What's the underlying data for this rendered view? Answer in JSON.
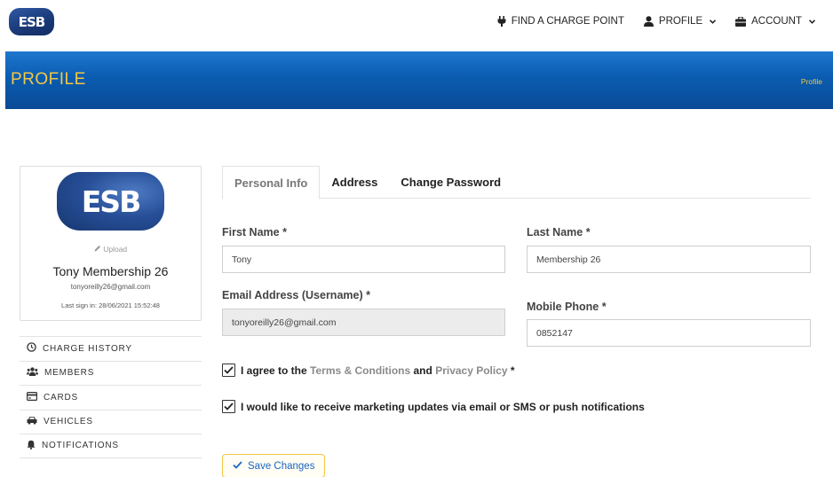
{
  "brand": {
    "logo_text": "ESB"
  },
  "nav": {
    "find_charge_point": "FIND A CHARGE POINT",
    "profile": "PROFILE",
    "account": "ACCOUNT"
  },
  "banner": {
    "title": "PROFILE",
    "breadcrumb": "Profile"
  },
  "profile_card": {
    "upload_label": "Upload",
    "name": "Tony Membership 26",
    "email": "tonyoreilly26@gmail.com",
    "last_sign_in": "Last sign in: 28/06/2021 15:52:48"
  },
  "side_menu": {
    "items": [
      {
        "label": "CHARGE HISTORY",
        "icon": "clock-icon"
      },
      {
        "label": "MEMBERS",
        "icon": "users-icon"
      },
      {
        "label": "CARDS",
        "icon": "credit-card-icon"
      },
      {
        "label": "VEHICLES",
        "icon": "car-icon"
      },
      {
        "label": "NOTIFICATIONS",
        "icon": "bell-icon"
      }
    ]
  },
  "tabs": [
    {
      "label": "Personal Info",
      "active": true
    },
    {
      "label": "Address",
      "active": false
    },
    {
      "label": "Change Password",
      "active": false
    }
  ],
  "form": {
    "first_name": {
      "label": "First Name *",
      "value": "Tony"
    },
    "last_name": {
      "label": "Last Name *",
      "value": "Membership 26"
    },
    "email": {
      "label": "Email Address (Username) *",
      "value": "tonyoreilly26@gmail.com"
    },
    "mobile": {
      "label": "Mobile Phone *",
      "value": "0852147"
    },
    "terms": {
      "prefix": "I agree to the",
      "terms_link": "Terms & Conditions",
      "and": "and",
      "privacy_link": "Privacy Policy",
      "suffix": "*",
      "checked": true
    },
    "marketing": {
      "label": "I would like to receive marketing updates via email or SMS or push notifications",
      "checked": true
    },
    "save_label": "Save Changes"
  },
  "colors": {
    "banner_blue": "#0a5cb0",
    "accent_yellow": "#f2c744",
    "link_blue": "#1a66c2"
  }
}
